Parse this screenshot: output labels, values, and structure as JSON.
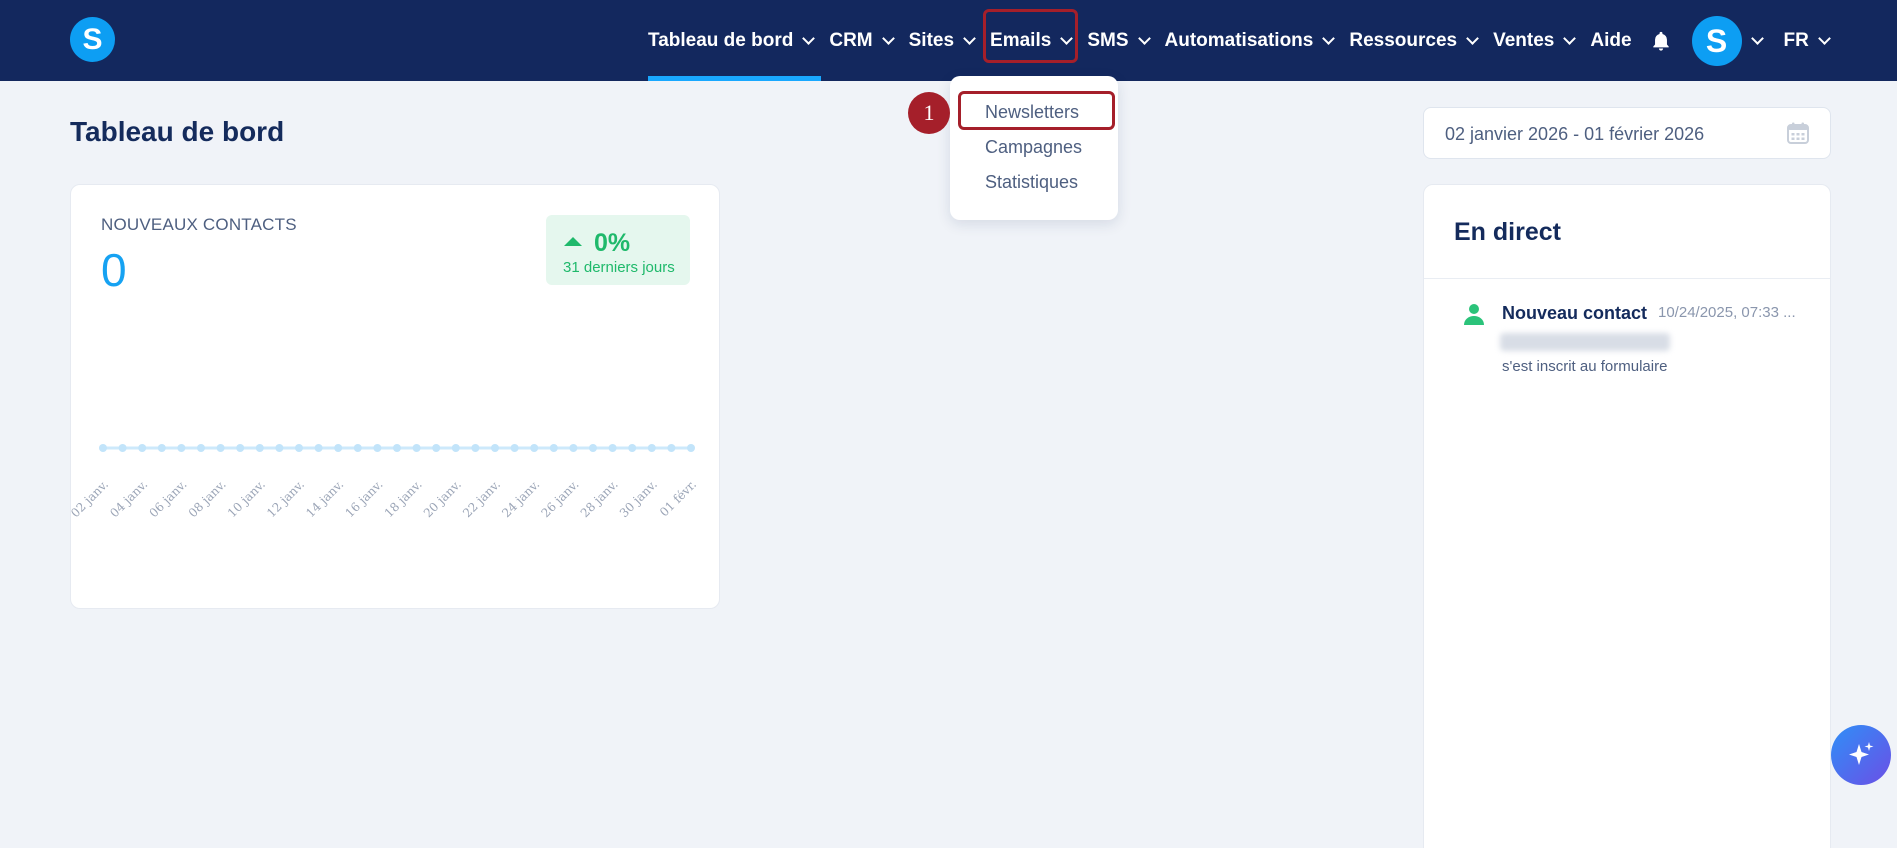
{
  "header": {
    "logo_letter": "S",
    "nav": [
      {
        "label": "Tableau de bord",
        "active": true
      },
      {
        "label": "CRM"
      },
      {
        "label": "Sites"
      },
      {
        "label": "Emails",
        "highlighted": true
      },
      {
        "label": "SMS"
      },
      {
        "label": "Automatisations"
      },
      {
        "label": "Ressources"
      },
      {
        "label": "Ventes"
      },
      {
        "label": "Aide"
      }
    ],
    "bell_icon": "bell-icon",
    "avatar_letter": "S",
    "language": "FR"
  },
  "dropdown": {
    "items": [
      "Newsletters",
      "Campagnes",
      "Statistiques"
    ],
    "step_number": "1"
  },
  "page": {
    "title": "Tableau de bord",
    "date_range": "02 janvier 2026 - 01 février 2026"
  },
  "contacts_card": {
    "label": "NOUVEAUX CONTACTS",
    "value": "0",
    "change": "0%",
    "period": "31 derniers jours"
  },
  "chart_data": {
    "type": "line",
    "categories": [
      "02 janv.",
      "03 janv.",
      "04 janv.",
      "05 janv.",
      "06 janv.",
      "07 janv.",
      "08 janv.",
      "09 janv.",
      "10 janv.",
      "11 janv.",
      "12 janv.",
      "13 janv.",
      "14 janv.",
      "15 janv.",
      "16 janv.",
      "17 janv.",
      "18 janv.",
      "19 janv.",
      "20 janv.",
      "21 janv.",
      "22 janv.",
      "23 janv.",
      "24 janv.",
      "25 janv.",
      "26 janv.",
      "27 janv.",
      "28 janv.",
      "29 janv.",
      "30 janv.",
      "31 janv.",
      "01 févr."
    ],
    "tick_labels": [
      "02 janv.",
      "04 janv.",
      "06 janv.",
      "08 janv.",
      "10 janv.",
      "12 janv.",
      "14 janv.",
      "16 janv.",
      "18 janv.",
      "20 janv.",
      "22 janv.",
      "24 janv.",
      "26 janv.",
      "28 janv.",
      "30 janv.",
      "01 févr."
    ],
    "values": [
      0,
      0,
      0,
      0,
      0,
      0,
      0,
      0,
      0,
      0,
      0,
      0,
      0,
      0,
      0,
      0,
      0,
      0,
      0,
      0,
      0,
      0,
      0,
      0,
      0,
      0,
      0,
      0,
      0,
      0,
      0
    ],
    "grid": false,
    "line_color": "#cde9fb",
    "point_color": "#c2e4fa"
  },
  "live_card": {
    "title": "En direct",
    "event": {
      "name": "Nouveau contact",
      "time": "10/24/2025, 07:33 ...",
      "description": "s'est inscrit au formulaire"
    }
  },
  "fab_icon": "sparkle-icon"
}
